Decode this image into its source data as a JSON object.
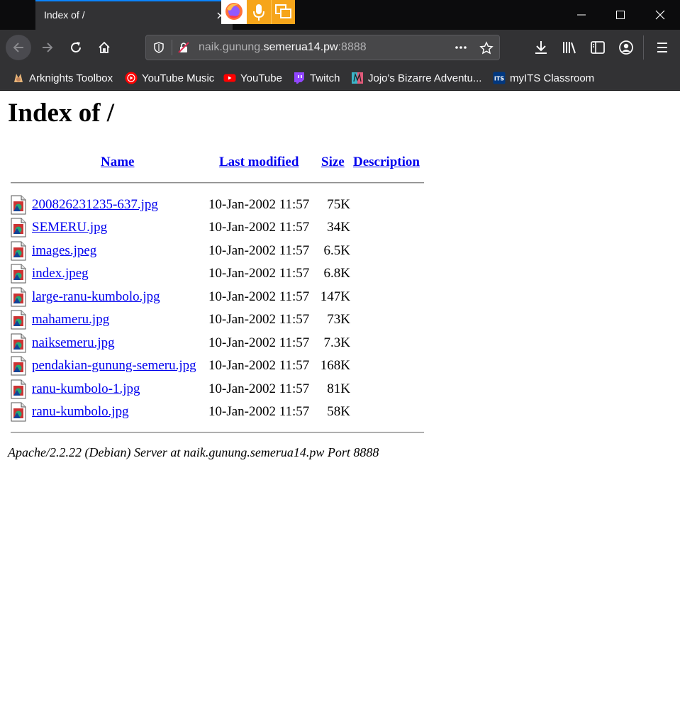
{
  "browser": {
    "tab": {
      "title": "Index of /"
    },
    "url": {
      "prefix": "naik.gunung.",
      "host": "semerua14.pw",
      "port": ":8888"
    }
  },
  "bookmarks": [
    {
      "label": "Arknights Toolbox",
      "icon": "arknights-icon"
    },
    {
      "label": "YouTube Music",
      "icon": "youtube-music-icon"
    },
    {
      "label": "YouTube",
      "icon": "youtube-icon"
    },
    {
      "label": "Twitch",
      "icon": "twitch-icon"
    },
    {
      "label": "Jojo's Bizarre Adventu...",
      "icon": "jojo-icon"
    },
    {
      "label": "myITS Classroom",
      "icon": "myits-icon"
    }
  ],
  "page": {
    "title": "Index of /",
    "columns": {
      "name": "Name",
      "modified": "Last modified",
      "size": "Size",
      "description": "Description"
    },
    "files": [
      {
        "name": "200826231235-637.jpg",
        "modified": "10-Jan-2002 11:57",
        "size": "75K"
      },
      {
        "name": "SEMERU.jpg",
        "modified": "10-Jan-2002 11:57",
        "size": "34K"
      },
      {
        "name": "images.jpeg",
        "modified": "10-Jan-2002 11:57",
        "size": "6.5K"
      },
      {
        "name": "index.jpeg",
        "modified": "10-Jan-2002 11:57",
        "size": "6.8K"
      },
      {
        "name": "large-ranu-kumbolo.jpg",
        "modified": "10-Jan-2002 11:57",
        "size": "147K"
      },
      {
        "name": "mahameru.jpg",
        "modified": "10-Jan-2002 11:57",
        "size": "73K"
      },
      {
        "name": "naiksemeru.jpg",
        "modified": "10-Jan-2002 11:57",
        "size": "7.3K"
      },
      {
        "name": "pendakian-gunung-semeru.jpg",
        "modified": "10-Jan-2002 11:57",
        "size": "168K"
      },
      {
        "name": "ranu-kumbolo-1.jpg",
        "modified": "10-Jan-2002 11:57",
        "size": "81K"
      },
      {
        "name": "ranu-kumbolo.jpg",
        "modified": "10-Jan-2002 11:57",
        "size": "58K"
      }
    ],
    "footer": "Apache/2.2.22 (Debian) Server at naik.gunung.semerua14.pw Port 8888"
  },
  "colors": {
    "link": "#0000ee",
    "toolbar": "#323234",
    "tab_accent": "#0a84ff"
  }
}
